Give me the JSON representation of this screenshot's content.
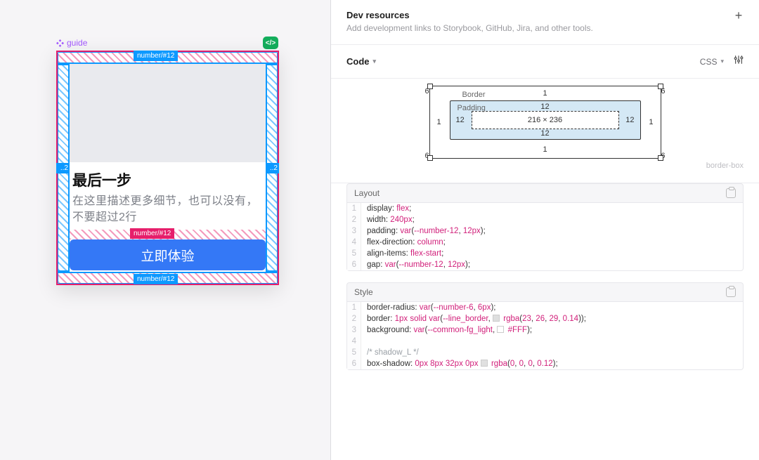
{
  "canvas": {
    "component_name": "guide",
    "code_badge": "</>",
    "tokens": {
      "padding": "number/#12",
      "edge": "..2",
      "gap": "number/#12",
      "bottom": "number/#12"
    },
    "card": {
      "title": "最后一步",
      "subtitle": "在这里描述更多细节，也可以没有，不要超过2行",
      "cta": "立即体验"
    }
  },
  "inspector": {
    "dev": {
      "title": "Dev resources",
      "subtitle": "Add development links to Storybook, GitHub, Jira, and other tools."
    },
    "code": {
      "label": "Code",
      "lang": "CSS"
    },
    "boxmodel": {
      "border_label": "Border",
      "padding_label": "Padding",
      "border": {
        "t": "1",
        "r": "1",
        "b": "1",
        "l": "1"
      },
      "radius": "6",
      "padding": {
        "t": "12",
        "r": "12",
        "b": "12",
        "l": "12"
      },
      "content": "216 × 236",
      "mode": "border-box"
    },
    "layout_block": {
      "title": "Layout",
      "lines": [
        [
          {
            "p": "display"
          },
          ": ",
          {
            "v": "flex"
          },
          ";"
        ],
        [
          {
            "p": "width"
          },
          ": ",
          {
            "v": "240px"
          },
          ";"
        ],
        [
          {
            "p": "padding"
          },
          ": ",
          {
            "f": "var"
          },
          "(",
          {
            "var": "--number-12"
          },
          ", ",
          {
            "v": "12px"
          },
          ");"
        ],
        [
          {
            "p": "flex-direction"
          },
          ": ",
          {
            "v": "column"
          },
          ";"
        ],
        [
          {
            "p": "align-items"
          },
          ": ",
          {
            "v": "flex-start"
          },
          ";"
        ],
        [
          {
            "p": "gap"
          },
          ": ",
          {
            "f": "var"
          },
          "(",
          {
            "var": "--number-12"
          },
          ", ",
          {
            "v": "12px"
          },
          ");"
        ]
      ]
    },
    "style_block": {
      "title": "Style",
      "lines": [
        [
          {
            "p": "border-radius"
          },
          ": ",
          {
            "f": "var"
          },
          "(",
          {
            "var": "--number-6"
          },
          ", ",
          {
            "v": "6px"
          },
          ");"
        ],
        [
          {
            "p": "border"
          },
          ": ",
          {
            "v": "1px solid"
          },
          " ",
          {
            "f": "var"
          },
          "(",
          {
            "var": "--line_border"
          },
          ", ",
          {
            "sw": "rgba(23,26,29,0.14)"
          },
          " ",
          {
            "v": "rgba"
          },
          "(",
          {
            "n": "23"
          },
          ", ",
          {
            "n": "26"
          },
          ", ",
          {
            "n": "29"
          },
          ", ",
          {
            "n": "0.14"
          },
          "));"
        ],
        [
          {
            "p": "background"
          },
          ": ",
          {
            "f": "var"
          },
          "(",
          {
            "var": "--common-fg_light"
          },
          ", ",
          {
            "sw": "#FFF"
          },
          " ",
          {
            "hex": "#FFF"
          },
          ");"
        ],
        [],
        [
          {
            "c": "/* shadow_L */"
          }
        ],
        [
          {
            "p": "box-shadow"
          },
          ": ",
          {
            "v": "0px 8px 32px 0px"
          },
          " ",
          {
            "sw": "rgba(0,0,0,0.12)"
          },
          " ",
          {
            "v": "rgba"
          },
          "(",
          {
            "n": "0"
          },
          ", ",
          {
            "n": "0"
          },
          ", ",
          {
            "n": "0"
          },
          ", ",
          {
            "n": "0.12"
          },
          ");"
        ]
      ]
    }
  }
}
